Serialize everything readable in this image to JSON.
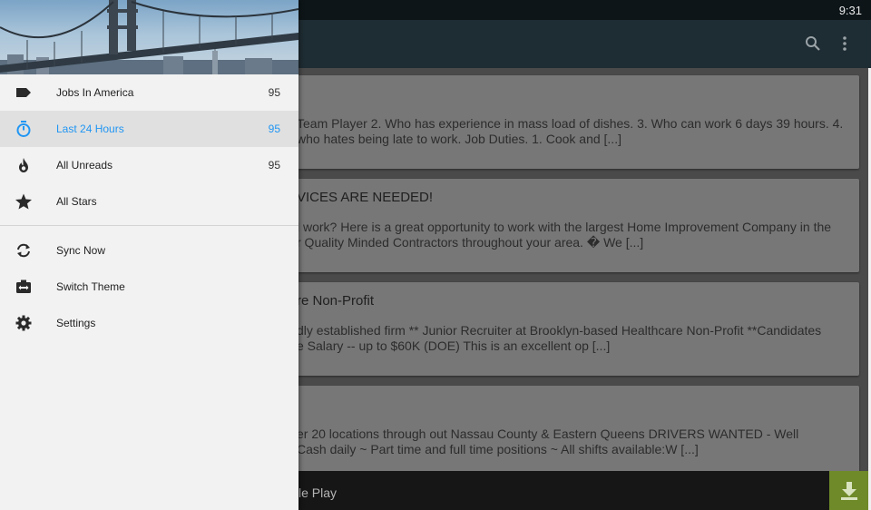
{
  "status_bar": {
    "time": "9:31"
  },
  "app_bar": {
    "search_icon": "search-icon",
    "overflow_icon": "more-vert-icon"
  },
  "articles": [
    {
      "title": "",
      "excerpt_line1": "Team Player 2. Who has experience in mass load of dishes. 3. Who can work 6 days 39 hours. 4.",
      "excerpt_line2": "who hates being late to work. Job Duties. 1. Cook and [...]"
    },
    {
      "title": "VICES ARE NEEDED!",
      "excerpt_line1": "l work? Here is a great opportunity to work with the largest Home Improvement Company in the",
      "excerpt_line2": "r Quality Minded Contractors throughout your area. � We [...]"
    },
    {
      "title": "re Non-Profit",
      "excerpt_line1": "dly established firm ** Junior Recruiter at Brooklyn-based Healthcare Non-Profit **Candidates",
      "excerpt_line2": "e Salary -- up to $60K (DOE) This is an excellent op [...]"
    },
    {
      "title": "",
      "excerpt_line1": "er 20 locations through out Nassau County & Eastern Queens DRIVERS WANTED - Well",
      "excerpt_line2": "Cash daily ~ Part time and full time positions ~ All shifts available:W [...]"
    }
  ],
  "bottom_bar": {
    "label": "le Play",
    "download_icon": "download-icon",
    "accent_color": "#6f8a29"
  },
  "drawer": {
    "accent_color": "#2196f3",
    "feeds": [
      {
        "icon": "label-icon",
        "label": "Jobs In America",
        "count": "95",
        "active": false
      },
      {
        "icon": "timer-icon",
        "label": "Last 24 Hours",
        "count": "95",
        "active": true
      },
      {
        "icon": "fire-icon",
        "label": "All Unreads",
        "count": "95",
        "active": false
      },
      {
        "icon": "star-icon",
        "label": "All Stars",
        "count": "",
        "active": false
      }
    ],
    "actions": [
      {
        "icon": "sync-icon",
        "label": "Sync Now"
      },
      {
        "icon": "theme-icon",
        "label": "Switch Theme"
      },
      {
        "icon": "gear-icon",
        "label": "Settings"
      }
    ]
  }
}
